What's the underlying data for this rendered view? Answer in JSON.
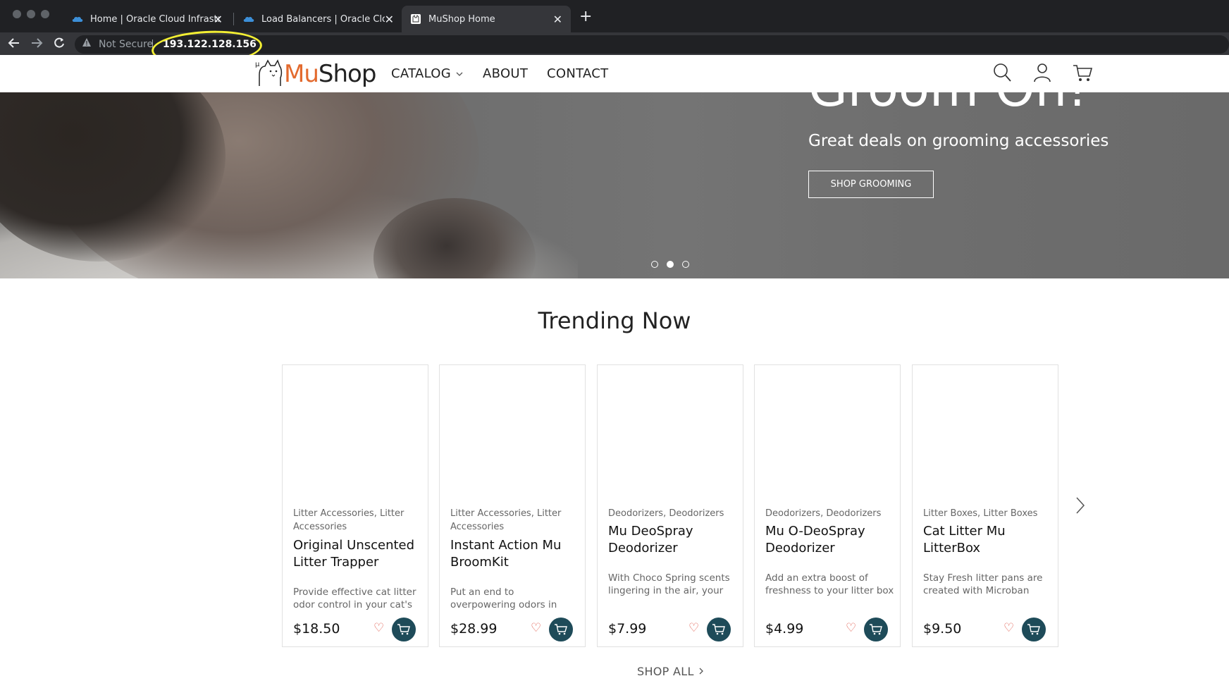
{
  "browser": {
    "tabs": [
      {
        "title": "Home | Oracle Cloud Infrastructure",
        "active": false,
        "icon": "oracle-cloud-icon"
      },
      {
        "title": "Load Balancers | Oracle Cloud Infrastructure",
        "active": false,
        "icon": "oracle-cloud-icon"
      },
      {
        "title": "MuShop Home",
        "active": true,
        "icon": "mushop-favicon-icon"
      }
    ],
    "security_label": "Not Secure",
    "url": "193.122.128.156"
  },
  "site": {
    "logo": {
      "mu": "Mu",
      "shop": "Shop"
    },
    "menu": {
      "catalog": "CATALOG",
      "about": "ABOUT",
      "contact": "CONTACT"
    }
  },
  "hero": {
    "title": "Groom On!",
    "subtitle": "Great deals on grooming accessories",
    "button": "SHOP GROOMING",
    "active_slide": 2,
    "slide_count": 3
  },
  "trending": {
    "title": "Trending Now",
    "products": [
      {
        "categories": "Litter Accessories, Litter Accessories",
        "name": "Original Unscented Litter Trapper",
        "description": "Provide effective cat litter odor control in your cat's",
        "price": "$18.50"
      },
      {
        "categories": "Litter Accessories, Litter Accessories",
        "name": "Instant Action Mu BroomKit",
        "description": "Put an end to overpowering odors in",
        "price": "$28.99"
      },
      {
        "categories": "Deodorizers, Deodorizers",
        "name": "Mu DeoSpray Deodorizer",
        "description": "With Choco Spring scents lingering in the air, your",
        "price": "$7.99"
      },
      {
        "categories": "Deodorizers, Deodorizers",
        "name": "Mu O-DeoSpray Deodorizer",
        "description": "Add an extra boost of freshness to your litter box",
        "price": "$4.99"
      },
      {
        "categories": "Litter Boxes, Litter Boxes",
        "name": "Cat Litter Mu LitterBox",
        "description": "Stay Fresh litter pans are created with Microban",
        "price": "$9.50"
      }
    ],
    "shop_all": "SHOP ALL"
  },
  "colors": {
    "brand_orange": "#e36a2e",
    "cart_button": "#1e4b59",
    "heart": "#e15b4e",
    "annotation": "#f3ef33"
  }
}
